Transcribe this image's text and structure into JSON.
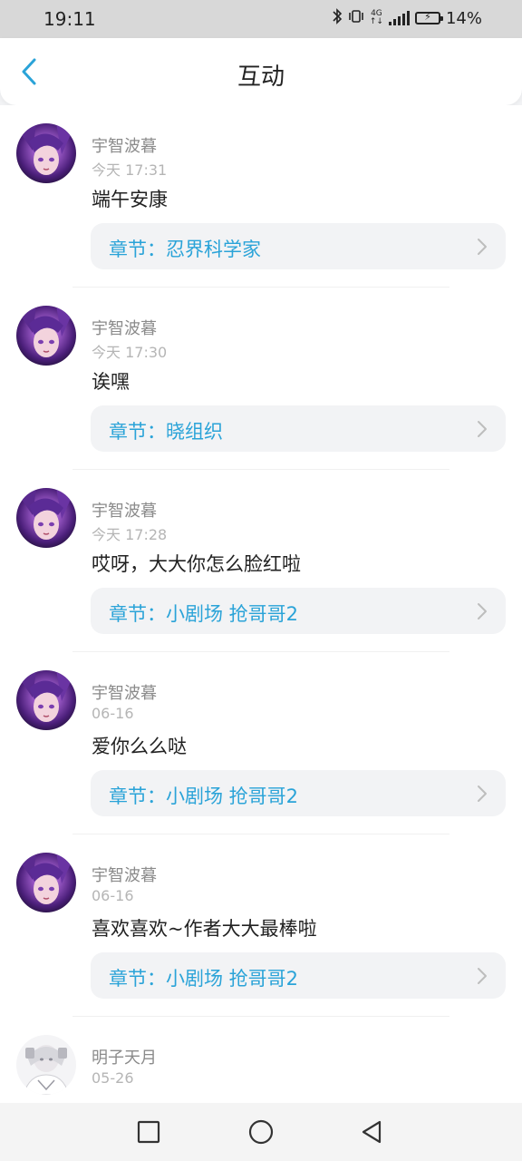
{
  "status_bar": {
    "time": "19:11",
    "network_top": "4G",
    "network_bottom": "↑↓",
    "battery": "14%"
  },
  "header": {
    "title": "互动"
  },
  "comments": [
    {
      "user": "宇智波暮",
      "time": "今天 17:31",
      "text": "端午安康",
      "chapter": "章节：忍界科学家",
      "avatar": "purple"
    },
    {
      "user": "宇智波暮",
      "time": "今天 17:30",
      "text": "诶嘿",
      "chapter": "章节：晓组织",
      "avatar": "purple"
    },
    {
      "user": "宇智波暮",
      "time": "今天 17:28",
      "text": "哎呀，大大你怎么脸红啦",
      "chapter": "章节：小剧场 抢哥哥2",
      "avatar": "purple"
    },
    {
      "user": "宇智波暮",
      "time": "06-16",
      "text": "爱你么么哒",
      "chapter": "章节：小剧场 抢哥哥2",
      "avatar": "purple"
    },
    {
      "user": "宇智波暮",
      "time": "06-16",
      "text": "喜欢喜欢~作者大大最棒啦",
      "chapter": "章节：小剧场 抢哥哥2",
      "avatar": "purple"
    },
    {
      "user": "明子天月",
      "time": "05-26",
      "text": "",
      "chapter": "",
      "avatar": "white"
    }
  ],
  "colors": {
    "accent": "#2aa3d8",
    "page_bg": "#f2f3f5"
  },
  "icons": {
    "back": "chevron-left-icon",
    "chapter_arrow": "chevron-right-icon",
    "nav_recent": "square-icon",
    "nav_home": "circle-icon",
    "nav_back": "triangle-icon",
    "bluetooth": "bluetooth-icon",
    "vibrate": "vibrate-icon",
    "signal": "signal-icon",
    "battery": "battery-charging-icon"
  }
}
